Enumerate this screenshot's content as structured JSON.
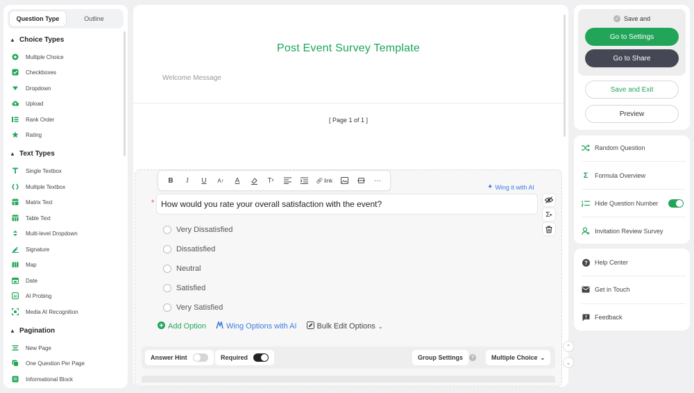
{
  "left_panel": {
    "tabs": [
      "Question Type",
      "Outline"
    ],
    "groups": [
      {
        "title": "Choice Types",
        "items": [
          {
            "label": "Multiple Choice",
            "icon": "radio-icon"
          },
          {
            "label": "Checkboxes",
            "icon": "checkbox-icon"
          },
          {
            "label": "Dropdown",
            "icon": "dropdown-icon"
          },
          {
            "label": "Upload",
            "icon": "upload-icon"
          },
          {
            "label": "Rank Order",
            "icon": "rank-order-icon"
          },
          {
            "label": "Rating",
            "icon": "star-icon"
          }
        ]
      },
      {
        "title": "Text Types",
        "items": [
          {
            "label": "Single Textbox",
            "icon": "text-icon"
          },
          {
            "label": "Multiple Textbox",
            "icon": "braces-icon"
          },
          {
            "label": "Matrix Text",
            "icon": "matrix-icon"
          },
          {
            "label": "Table Text",
            "icon": "table-icon"
          },
          {
            "label": "Multi-level Dropdown",
            "icon": "multi-dropdown-icon"
          },
          {
            "label": "Signature",
            "icon": "signature-icon"
          },
          {
            "label": "Map",
            "icon": "map-icon"
          },
          {
            "label": "Date",
            "icon": "calendar-icon"
          },
          {
            "label": "AI Probing",
            "icon": "ai-icon"
          },
          {
            "label": "Media AI Recognition",
            "icon": "scan-icon"
          }
        ]
      },
      {
        "title": "Pagination",
        "items": [
          {
            "label": "New Page",
            "icon": "new-page-icon"
          },
          {
            "label": "One Question Per Page",
            "icon": "one-per-page-icon"
          },
          {
            "label": "Informational Block",
            "icon": "info-block-icon"
          }
        ]
      }
    ]
  },
  "survey": {
    "title": "Post Event Survey Template",
    "welcome": "Welcome Message",
    "page_indicator": "[ Page 1 of 1 ]"
  },
  "toolbar": {
    "items": [
      "B",
      "I",
      "U",
      "AA",
      "A",
      "fill",
      "T",
      "align",
      "indent",
      "link",
      "image",
      "embed",
      "more"
    ],
    "link_label": "link"
  },
  "question": {
    "wing_ai": "Wing it with AI",
    "text": "How would you rate your overall satisfaction with the event?",
    "options": [
      "Very Dissatisfied",
      "Dissatisfied",
      "Neutral",
      "Satisfied",
      "Very Satisfied"
    ],
    "add_option": "Add Option",
    "wing_options": "Wing Options with AI",
    "bulk_edit": "Bulk Edit Options"
  },
  "bottom_bar": {
    "answer_hint": "Answer Hint",
    "answer_hint_on": false,
    "required": "Required",
    "required_on": true,
    "group_settings": "Group Settings",
    "question_type": "Multiple Choice"
  },
  "right_panel": {
    "save_status": "Save and",
    "go_settings": "Go to Settings",
    "go_share": "Go to Share",
    "save_exit": "Save and Exit",
    "preview": "Preview",
    "tools": [
      {
        "label": "Random Question",
        "icon": "shuffle-icon"
      },
      {
        "label": "Formula Overview",
        "icon": "sigma-icon"
      },
      {
        "label": "Hide Question Number",
        "icon": "numbered-list-icon",
        "toggle": true
      },
      {
        "label": "Invitation Review Survey",
        "icon": "invite-icon"
      }
    ],
    "help": [
      {
        "label": "Help Center",
        "icon": "help-icon"
      },
      {
        "label": "Get in Touch",
        "icon": "mail-icon"
      },
      {
        "label": "Feedback",
        "icon": "feedback-icon"
      }
    ]
  },
  "colors": {
    "accent_green": "#22a559",
    "title_green": "#19a657",
    "dark_button": "#454854",
    "ai_blue": "#3a7bdf"
  }
}
